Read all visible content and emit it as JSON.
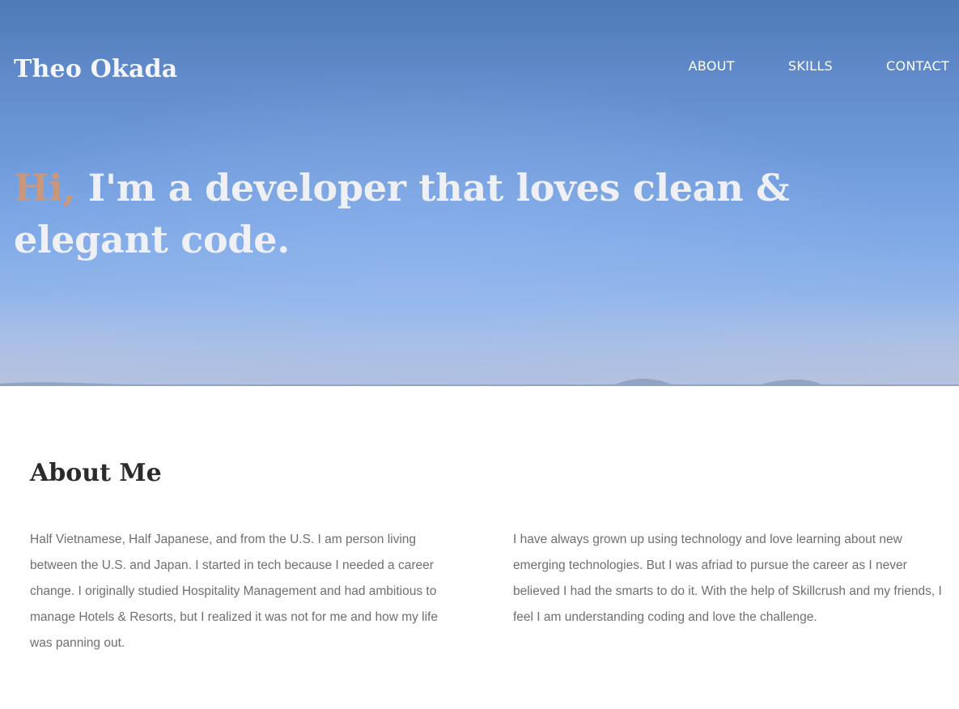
{
  "header": {
    "brand": "Theo Okada",
    "nav": [
      {
        "label": "ABOUT"
      },
      {
        "label": "SKILLS"
      },
      {
        "label": "CONTACT"
      }
    ]
  },
  "hero": {
    "greeting": "Hi,",
    "headline": " I'm a developer that loves clean & elegant code."
  },
  "about": {
    "title": "About Me",
    "paragraphs": [
      "Half Vietnamese, Half Japanese, and from the U.S. I am person living between the U.S. and Japan. I started in tech because I needed a career change. I originally studied Hospitality Management and had ambitious to manage Hotels & Resorts, but I realized it was not for me and how my life was panning out.",
      "I have always grown up using technology and love learning about new emerging technologies. But I was afriad to pursue the career as I never believed I had the smarts to do it. With the help of Skillcrush and my friends, I feel I am understanding coding and love the challenge."
    ]
  },
  "colors": {
    "greeting_accent": "#c9977c",
    "body_text": "#6f6f6f",
    "heading_text": "#2b2b2b"
  }
}
